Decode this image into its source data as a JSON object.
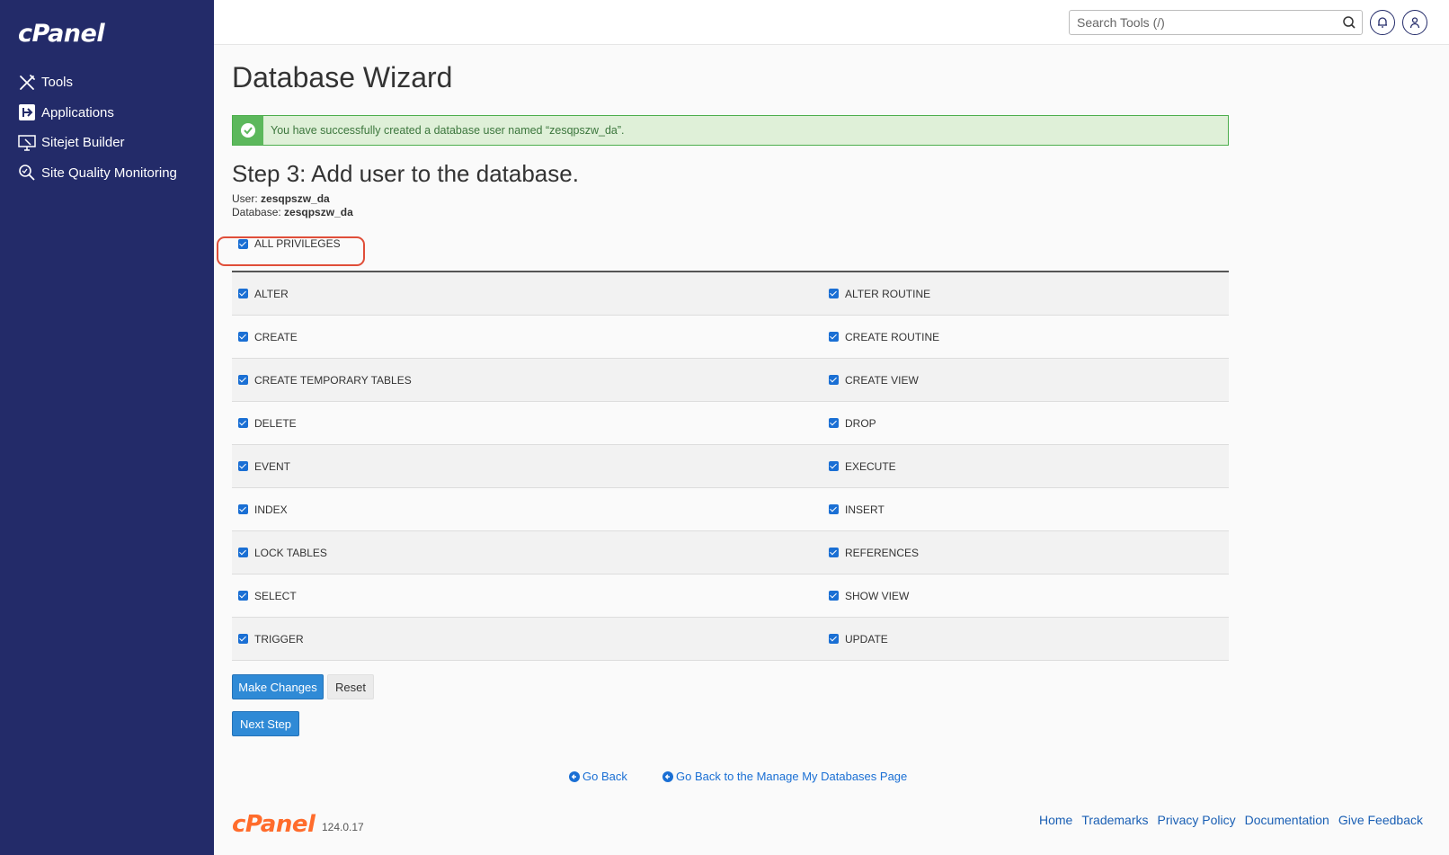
{
  "brand": {
    "logo": "cPanel",
    "version": "124.0.17"
  },
  "sidebar": {
    "items": [
      {
        "label": "Tools",
        "icon": "tools-icon"
      },
      {
        "label": "Applications",
        "icon": "applications-icon"
      },
      {
        "label": "Sitejet Builder",
        "icon": "sitejet-icon"
      },
      {
        "label": "Site Quality Monitoring",
        "icon": "magnifier-icon"
      }
    ]
  },
  "topbar": {
    "search_placeholder": "Search Tools (/)"
  },
  "page": {
    "title": "Database Wizard",
    "alert": "You have successfully created a database user named “zesqpszw_da”.",
    "step_title": "Step 3: Add user to the database.",
    "user_label": "User:",
    "user_value": "zesqpszw_da",
    "database_label": "Database:",
    "database_value": "zesqpszw_da",
    "all_privileges": "ALL PRIVILEGES",
    "privileges": [
      [
        "ALTER",
        "ALTER ROUTINE"
      ],
      [
        "CREATE",
        "CREATE ROUTINE"
      ],
      [
        "CREATE TEMPORARY TABLES",
        "CREATE VIEW"
      ],
      [
        "DELETE",
        "DROP"
      ],
      [
        "EVENT",
        "EXECUTE"
      ],
      [
        "INDEX",
        "INSERT"
      ],
      [
        "LOCK TABLES",
        "REFERENCES"
      ],
      [
        "SELECT",
        "SHOW VIEW"
      ],
      [
        "TRIGGER",
        "UPDATE"
      ]
    ],
    "make_changes": "Make Changes",
    "reset": "Reset",
    "next_step": "Next Step",
    "go_back": "Go Back",
    "go_back_manage": "Go Back to the Manage My Databases Page"
  },
  "footer": {
    "links": [
      "Home",
      "Trademarks",
      "Privacy Policy",
      "Documentation",
      "Give Feedback"
    ]
  },
  "colors": {
    "sidebar": "#232b69",
    "accent": "#2f8ad6",
    "success_bg": "#dff0d8",
    "highlight": "#e04e39",
    "footer_logo": "#ff6c2c"
  }
}
